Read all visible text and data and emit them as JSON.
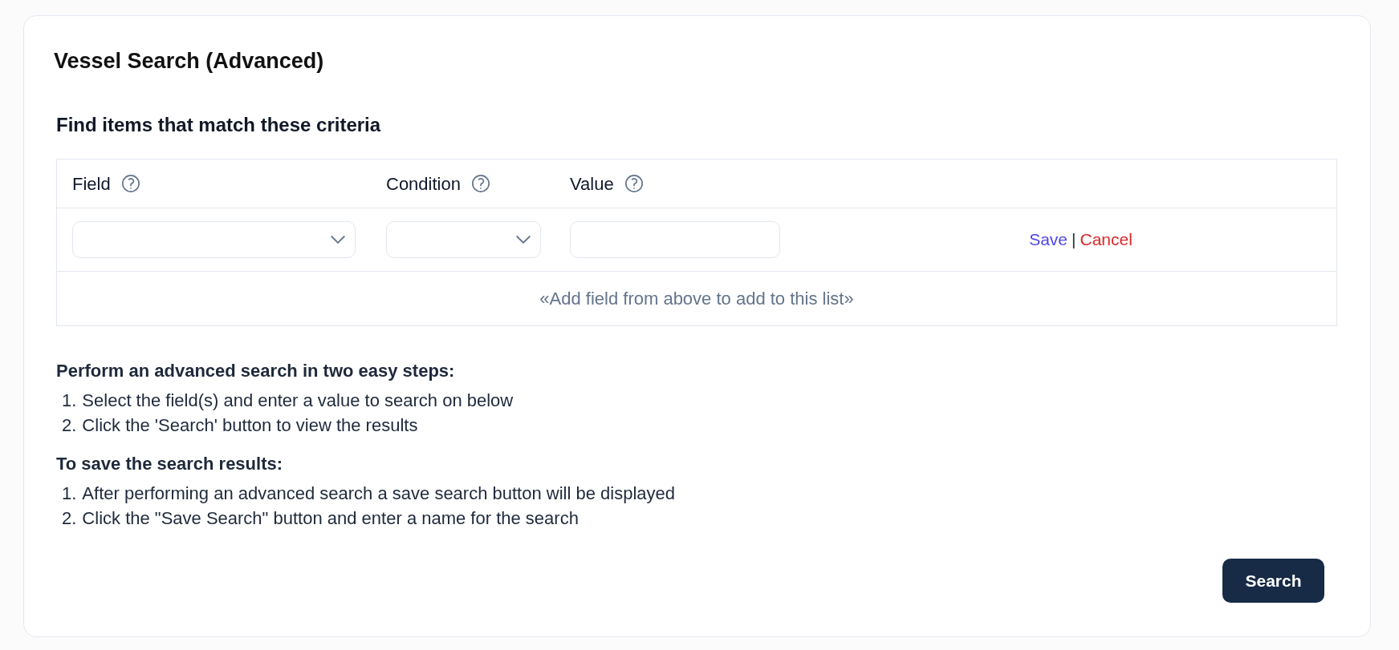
{
  "card": {
    "title": "Vessel Search (Advanced)"
  },
  "criteria": {
    "heading": "Find items that match these criteria",
    "columns": [
      {
        "label": "Field",
        "help": true
      },
      {
        "label": "Condition",
        "help": true
      },
      {
        "label": "Value",
        "help": true
      }
    ],
    "inputs": [
      {
        "kind": "dropdown"
      },
      {
        "kind": "dropdown"
      },
      {
        "kind": "text"
      }
    ],
    "actions": [
      {
        "kind": "save",
        "label": "Save"
      },
      {
        "kind": "cancel",
        "label": "Cancel"
      }
    ],
    "action_separator": "|",
    "empty_message": "«Add field from above to add to this list»"
  },
  "instructions": [
    {
      "heading": "Perform an advanced search in two easy steps:",
      "steps": [
        {
          "number": "1.",
          "text": "Select the field(s) and enter a value to search on below"
        },
        {
          "number": "2.",
          "text": "Click the 'Search' button to view the results"
        }
      ]
    },
    {
      "heading": "To save the search results:",
      "steps": [
        {
          "number": "1.",
          "text": "After performing an advanced search a save search button will be displayed"
        },
        {
          "number": "2.",
          "text": "Click the \"Save Search\" button and enter a name for the search"
        }
      ]
    }
  ],
  "search_button": {
    "label": "Search"
  }
}
